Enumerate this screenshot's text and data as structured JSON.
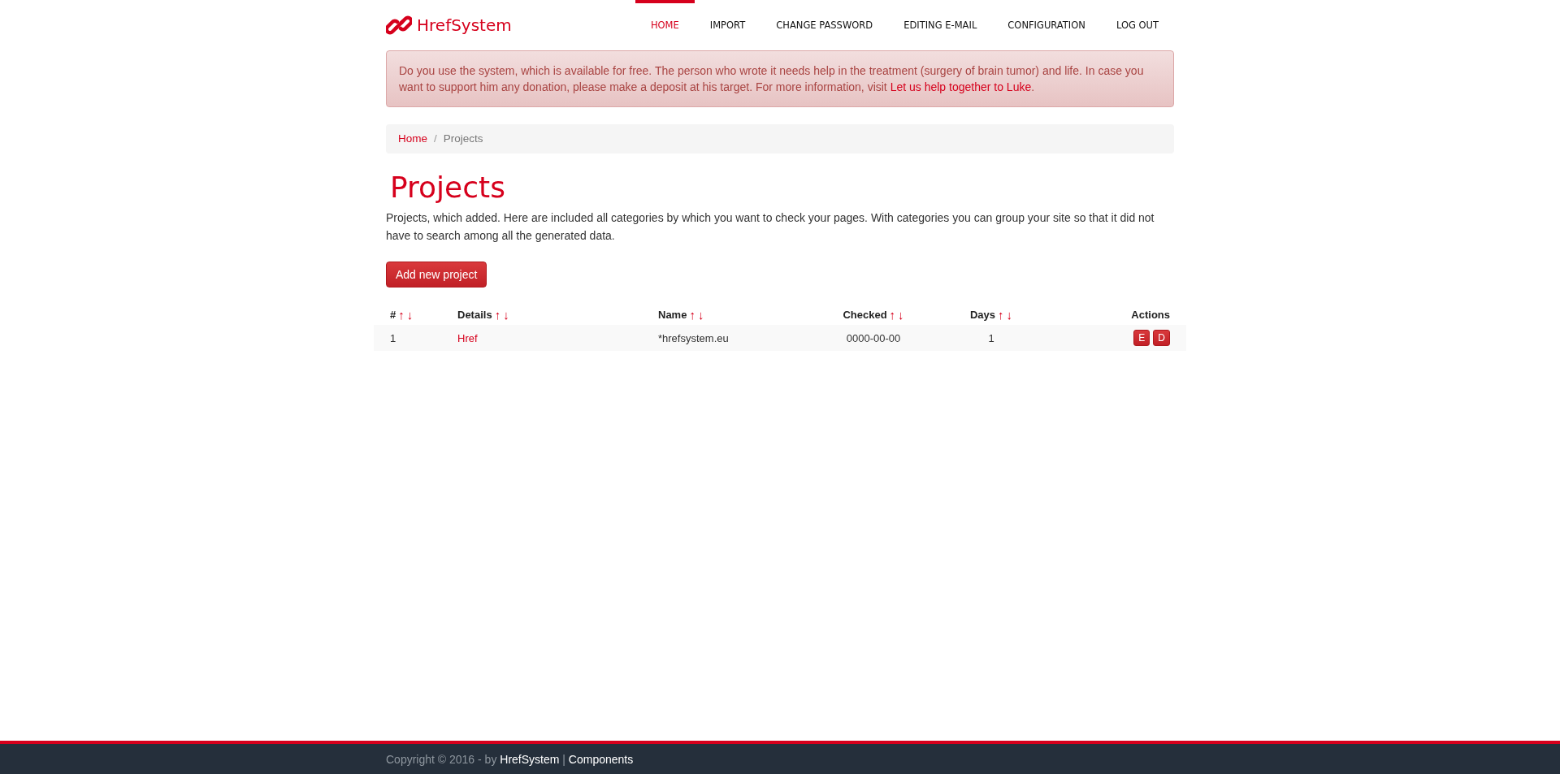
{
  "brand": "HrefSystem",
  "nav": [
    {
      "label": "HOME",
      "selected": true
    },
    {
      "label": "IMPORT",
      "selected": false
    },
    {
      "label": "CHANGE PASSWORD",
      "selected": false
    },
    {
      "label": "EDITING E-MAIL",
      "selected": false
    },
    {
      "label": "CONFIGURATION",
      "selected": false
    },
    {
      "label": "LOG OUT",
      "selected": false
    }
  ],
  "alert": {
    "text": "Do you use the system, which is available for free. The person who wrote it needs help in the treatment (surgery of brain tumor) and life. In case you want to support him any donation, please make a deposit at his target. For more information, visit ",
    "link": "Let us help together to Luke",
    "end": "."
  },
  "breadcrumb": [
    {
      "label": "Home",
      "kind": "link"
    },
    {
      "label": "Projects",
      "kind": "current"
    }
  ],
  "breadcrumb_separator": "/",
  "title": "Projects",
  "description": "Projects, which added. Here are included all categories by which you want to check your pages. With categories you can group your site so that it did not have to search among all the generated data.",
  "add_button": "Add new project",
  "table": {
    "columns": [
      {
        "label": "#",
        "sort_up": "↑",
        "sort_down": "↓"
      },
      {
        "label": "Details",
        "sort_up": "↑",
        "sort_down": "↓"
      },
      {
        "label": "Name",
        "sort_up": "↑",
        "sort_down": "↓"
      },
      {
        "label": "Checked",
        "sort_up": "↑",
        "sort_down": "↓"
      },
      {
        "label": "Days",
        "sort_up": "↑",
        "sort_down": "↓"
      },
      {
        "label": "Actions"
      }
    ],
    "rows": [
      {
        "id": "1",
        "details": "Href",
        "name": "*hrefsystem.eu",
        "checked": "0000-00-00",
        "days": "1",
        "actions": [
          "E",
          "D"
        ]
      }
    ]
  },
  "footer": {
    "prefix": "Copyright © 2016 - by ",
    "link1": "HrefSystem",
    "sep": " | ",
    "link2": "Components"
  }
}
